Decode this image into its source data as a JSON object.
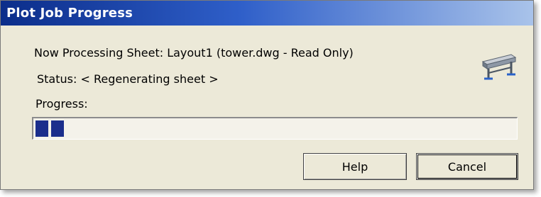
{
  "window": {
    "title": "Plot Job Progress"
  },
  "body": {
    "processing_text": "Now Processing Sheet: Layout1 (tower.dwg - Read Only)",
    "status_text": "Status: < Regenerating sheet >",
    "progress_label": "Progress:",
    "progress_fraction": 0.06,
    "icon": "plotter-icon"
  },
  "buttons": {
    "help_label": "Help",
    "cancel_label": "Cancel"
  },
  "colors": {
    "title_bar": "#0b2d8a",
    "progress_fill": "#1b2e8c",
    "dialog_bg": "#ece9d8"
  }
}
